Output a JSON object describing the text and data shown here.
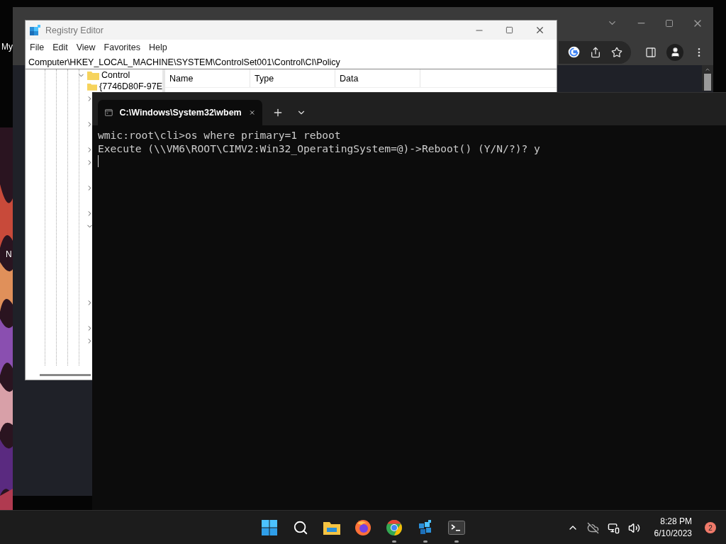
{
  "desktop": {
    "icon_labels": [
      "My",
      "N"
    ]
  },
  "registry_editor": {
    "title": "Registry Editor",
    "menu": [
      "File",
      "Edit",
      "View",
      "Favorites",
      "Help"
    ],
    "address": "Computer\\HKEY_LOCAL_MACHINE\\SYSTEM\\ControlSet001\\Control\\CI\\Policy",
    "tree": [
      {
        "label": "Control",
        "expanded": true,
        "children": [
          {
            "label": "{7746D80F-97E"
          }
        ]
      }
    ],
    "hidden_rows": [
      {
        "kind": "node",
        "expanded": false
      },
      {
        "kind": "spacer"
      },
      {
        "kind": "node",
        "expanded": false
      },
      {
        "kind": "spacer"
      },
      {
        "kind": "node",
        "expanded": false
      },
      {
        "kind": "node",
        "expanded": false
      },
      {
        "kind": "spacer"
      },
      {
        "kind": "node",
        "expanded": false
      },
      {
        "kind": "spacer"
      },
      {
        "kind": "node",
        "expanded": false
      },
      {
        "kind": "node",
        "expanded": true
      },
      {
        "kind": "spacer"
      },
      {
        "kind": "spacer"
      },
      {
        "kind": "spacer"
      },
      {
        "kind": "spacer"
      },
      {
        "kind": "spacer"
      },
      {
        "kind": "node",
        "expanded": false
      },
      {
        "kind": "spacer"
      },
      {
        "kind": "node",
        "expanded": false
      },
      {
        "kind": "node",
        "expanded": false
      }
    ],
    "columns": [
      "Name",
      "Type",
      "Data"
    ]
  },
  "terminal": {
    "tabs": [
      {
        "title": "C:\\Windows\\System32\\wbem",
        "selected": true
      }
    ],
    "lines": [
      "wmic:root\\cli>os where primary=1 reboot",
      "Execute (\\\\VM6\\ROOT\\CIMV2:Win32_OperatingSystem=@)->Reboot() (Y/N/?)? y"
    ]
  },
  "taskbar": {
    "apps": [
      {
        "kind": "start",
        "running": false
      },
      {
        "kind": "search",
        "running": false
      },
      {
        "kind": "explorer",
        "running": false
      },
      {
        "kind": "firefox",
        "running": false
      },
      {
        "kind": "chrome",
        "running": true
      },
      {
        "kind": "regedit",
        "running": true
      },
      {
        "kind": "terminal",
        "running": true
      }
    ],
    "time": "8:28 PM",
    "date": "6/10/2023",
    "notification_count": "2"
  }
}
